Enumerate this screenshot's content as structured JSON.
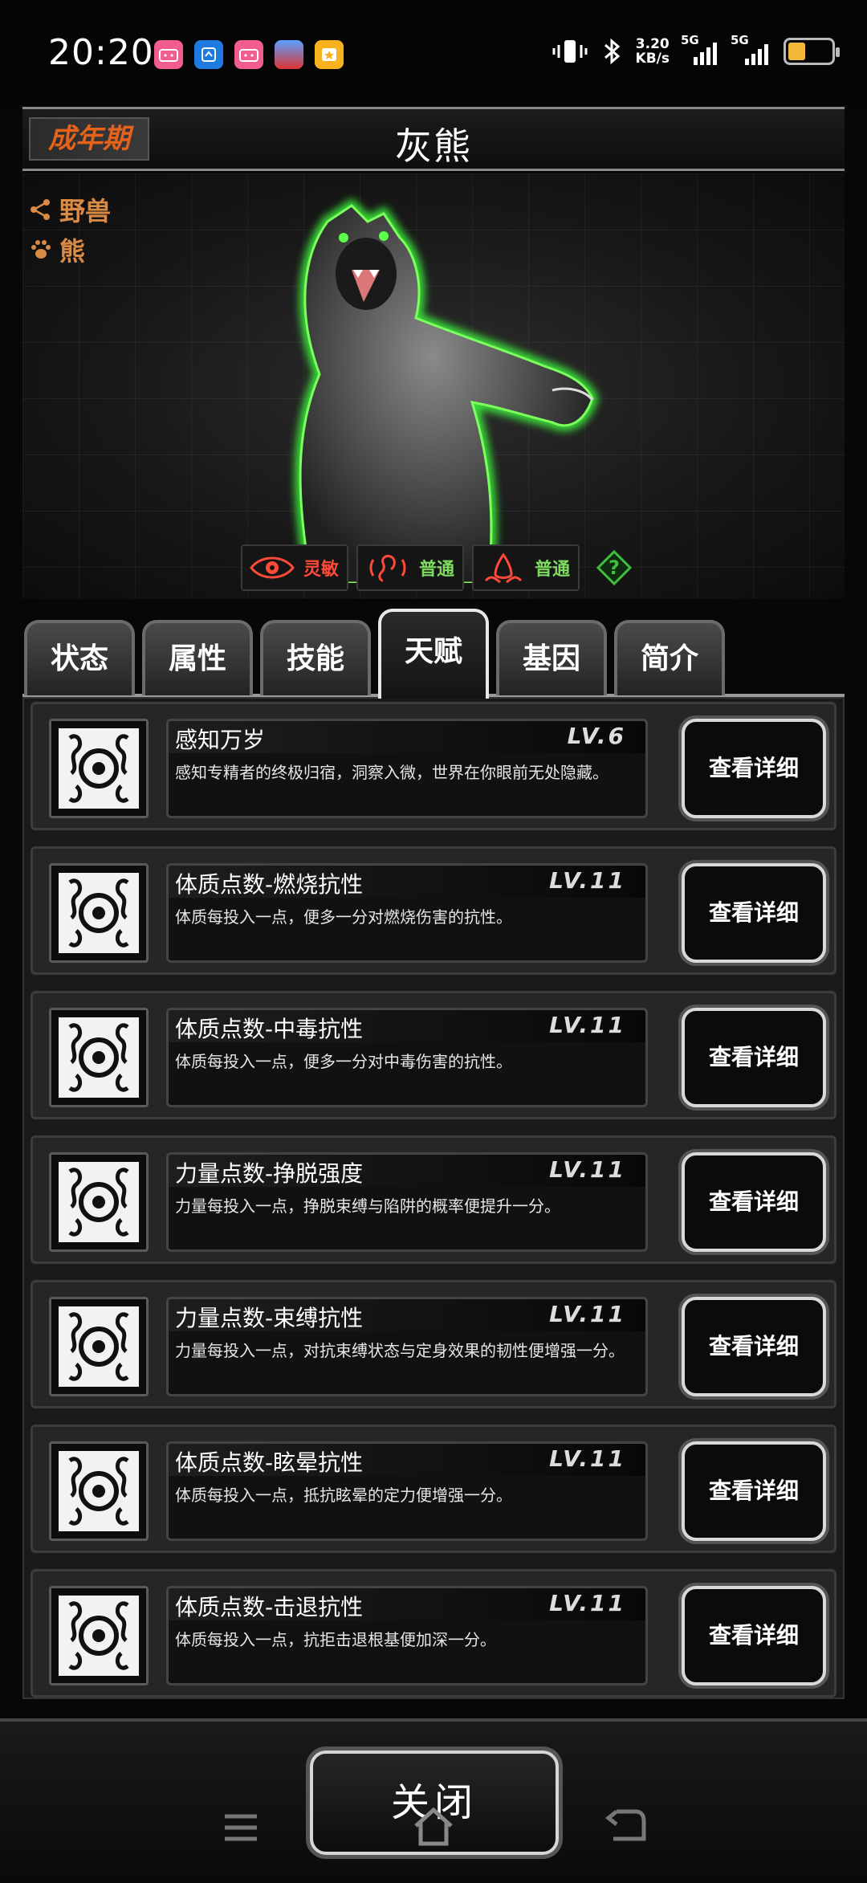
{
  "status_bar": {
    "time": "20:20",
    "net_speed": "3.20",
    "net_unit": "KB/s",
    "signal1_label": "5G",
    "signal2_label": "5G",
    "app_icons": [
      "bilibili-icon",
      "app-icon",
      "bilibili-icon",
      "game-icon",
      "star-icon"
    ],
    "battery_color": "#f4b83a"
  },
  "header": {
    "stage": "成年期",
    "species": "灰熊"
  },
  "tags": [
    {
      "icon": "share-icon",
      "label": "野兽"
    },
    {
      "icon": "paw-icon",
      "label": "熊"
    }
  ],
  "traits": [
    {
      "icon": "eye-icon",
      "value": "灵敏",
      "color": "#ff4a3a"
    },
    {
      "icon": "ear-icon",
      "value": "普通",
      "color": "#7ddc5f"
    },
    {
      "icon": "nose-icon",
      "value": "普通",
      "color": "#7ddc5f"
    }
  ],
  "tabs": [
    {
      "label": "状态",
      "active": false
    },
    {
      "label": "属性",
      "active": false
    },
    {
      "label": "技能",
      "active": false
    },
    {
      "label": "天赋",
      "active": true
    },
    {
      "label": "基因",
      "active": false
    },
    {
      "label": "简介",
      "active": false
    }
  ],
  "talents": [
    {
      "title": "感知万岁",
      "level": "LV.6",
      "desc": "感知专精者的终极归宿，洞察入微，世界在你眼前无处隐藏。",
      "button": "查看详细"
    },
    {
      "title": "体质点数-燃烧抗性",
      "level": "LV.11",
      "desc": "体质每投入一点，便多一分对燃烧伤害的抗性。",
      "button": "查看详细"
    },
    {
      "title": "体质点数-中毒抗性",
      "level": "LV.11",
      "desc": "体质每投入一点，便多一分对中毒伤害的抗性。",
      "button": "查看详细"
    },
    {
      "title": "力量点数-挣脱强度",
      "level": "LV.11",
      "desc": "力量每投入一点，挣脱束缚与陷阱的概率便提升一分。",
      "button": "查看详细"
    },
    {
      "title": "力量点数-束缚抗性",
      "level": "LV.11",
      "desc": "力量每投入一点，对抗束缚状态与定身效果的韧性便增强一分。",
      "button": "查看详细"
    },
    {
      "title": "体质点数-眩晕抗性",
      "level": "LV.11",
      "desc": "体质每投入一点，抵抗眩晕的定力便增强一分。",
      "button": "查看详细"
    },
    {
      "title": "体质点数-击退抗性",
      "level": "LV.11",
      "desc": "体质每投入一点，抗拒击退根基便加深一分。",
      "button": "查看详细"
    }
  ],
  "footer": {
    "close_label": "关闭"
  }
}
